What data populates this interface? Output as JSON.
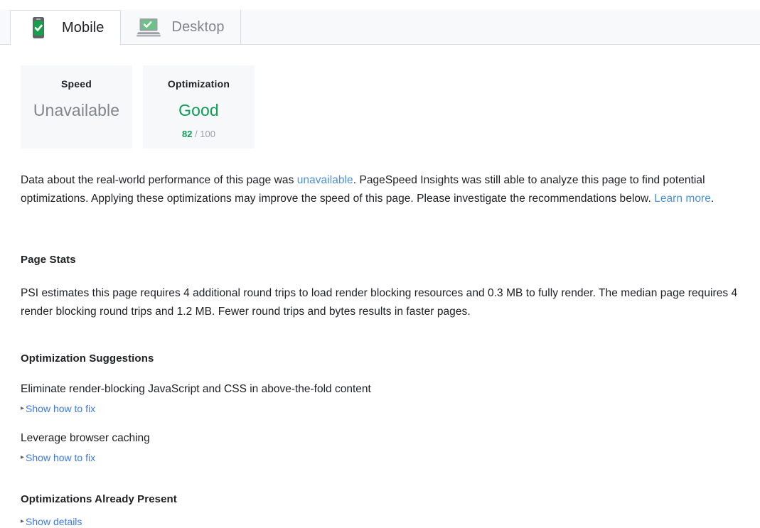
{
  "tabs": [
    {
      "label": "Mobile",
      "icon": "mobile-check-icon",
      "active": true
    },
    {
      "label": "Desktop",
      "icon": "desktop-check-icon",
      "active": false
    }
  ],
  "cards": [
    {
      "title": "Speed",
      "value": "Unavailable",
      "value_color": "#80868b",
      "score": null,
      "score_max": null
    },
    {
      "title": "Optimization",
      "value": "Good",
      "value_color": "#0d9d58",
      "score": "82",
      "score_max": "/ 100"
    }
  ],
  "intro": {
    "part1": "Data about the real-world performance of this page was ",
    "link1": "unavailable",
    "part2": ". PageSpeed Insights was still able to analyze this page to find potential optimizations. Applying these optimizations may improve the speed of this page. Please investigate the recommendations below. ",
    "link2": "Learn more",
    "part3": "."
  },
  "page_stats": {
    "heading": "Page Stats",
    "body": "PSI estimates this page requires 4 additional round trips to load render blocking resources and 0.3 MB to fully render. The median page requires 4 render blocking round trips and 1.2 MB. Fewer round trips and bytes results in faster pages."
  },
  "suggestions": {
    "heading": "Optimization Suggestions",
    "items": [
      {
        "title": "Eliminate render-blocking JavaScript and CSS in above-the-fold content",
        "action": "Show how to fix"
      },
      {
        "title": "Leverage browser caching",
        "action": "Show how to fix"
      }
    ]
  },
  "already_present": {
    "heading": "Optimizations Already Present",
    "action": "Show details"
  },
  "glyphs": {
    "triangle_right": "▸"
  },
  "colors": {
    "link": "#4a90d9",
    "action_link": "#3b78e7",
    "good_green": "#0d9d58",
    "muted_gray": "#80868b",
    "card_bg": "#f7f8f9",
    "tabbar_bg": "#f8f9fa",
    "border": "#dadce0"
  }
}
